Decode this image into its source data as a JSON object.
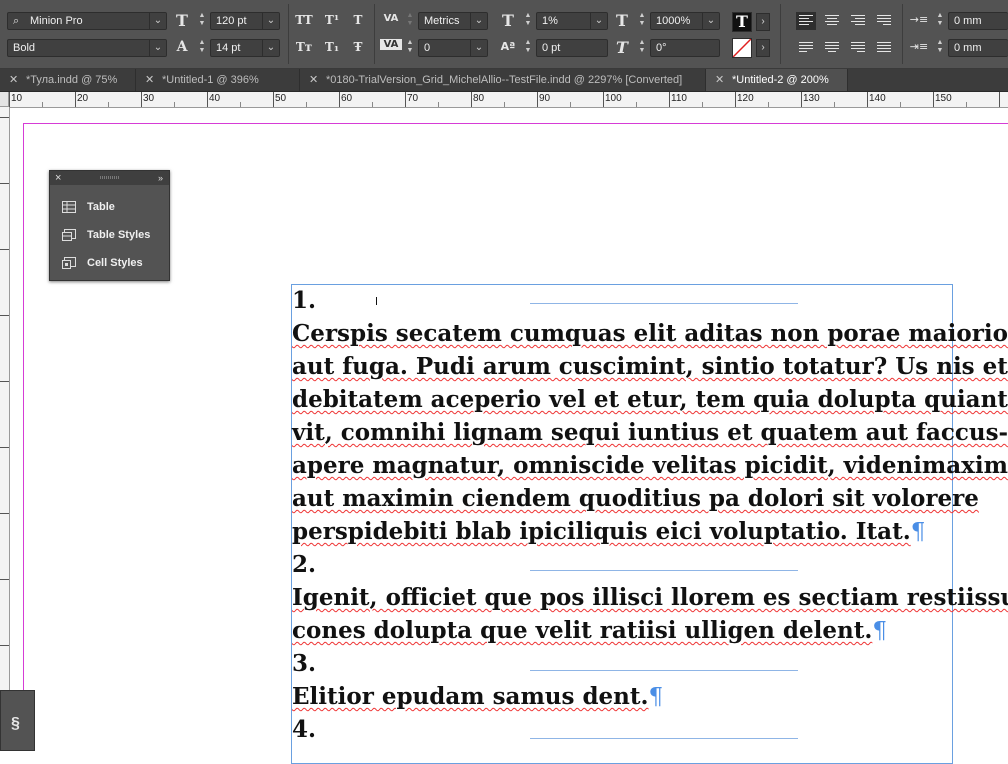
{
  "control_bar": {
    "font_family": "Minion Pro",
    "font_style": "Bold",
    "font_size": "120 pt",
    "leading": "14 pt",
    "kerning": "Metrics",
    "tracking": "0",
    "vertical_scale": "1%",
    "horizontal_scale": "1000%",
    "baseline_shift": "0 pt",
    "skew": "0°",
    "indent_left": "0 mm",
    "indent_first": "0 mm",
    "case_buttons": [
      "TT",
      "T¹",
      "T",
      "Tт",
      "T₁",
      "Ŧ"
    ]
  },
  "tabs": [
    {
      "label": "*Тула.indd @ 75%",
      "active": false
    },
    {
      "label": "*Untitled-1 @ 396%",
      "active": false
    },
    {
      "label": "*0180-TrialVersion_Grid_MichelAllio--TestFile.indd @ 2297% [Converted]",
      "active": false
    },
    {
      "label": "*Untitled-2 @ 200%",
      "active": true
    }
  ],
  "ruler": {
    "ticks": [
      "10",
      "20",
      "30",
      "40",
      "50",
      "60",
      "70",
      "80",
      "90",
      "100",
      "110",
      "120",
      "130",
      "140",
      "150"
    ]
  },
  "panel": {
    "items": [
      {
        "label": "Table",
        "icon": "table-icon"
      },
      {
        "label": "Table Styles",
        "icon": "table-styles-icon"
      },
      {
        "label": "Cell Styles",
        "icon": "cell-styles-icon"
      }
    ]
  },
  "story": {
    "lines": [
      "1.",
      "Cerspis secatem cumquas elit aditas non porae maiorios",
      "aut fuga. Pudi arum cuscimint, sintio totatur? Us nis et",
      "debitatem aceperio vel et etur, tem quia dolupta quianti",
      "vit, comnihi lignam sequi iuntius et quatem aut faccus-",
      "apere magnatur, omniscide velitas picidit, videnimaxim",
      "aut maximin ciendem quoditius pa dolori sit volorere",
      "perspidebiti blab ipiciliquis eici voluptatio. Itat.",
      "2.",
      "Igenit, officiet que pos illisci llorem es sectiam restiissus",
      "cones dolupta que velit ratiisi ulligen delent.",
      "3.",
      "Elitior epudam samus dent.",
      "4."
    ],
    "pilcrow": "¶"
  },
  "colors": {
    "margin_guide": "#d63cd6",
    "frame_edge": "#6aa0e0",
    "pilcrow": "#4a8ee6",
    "ui_dark": "#535353"
  }
}
